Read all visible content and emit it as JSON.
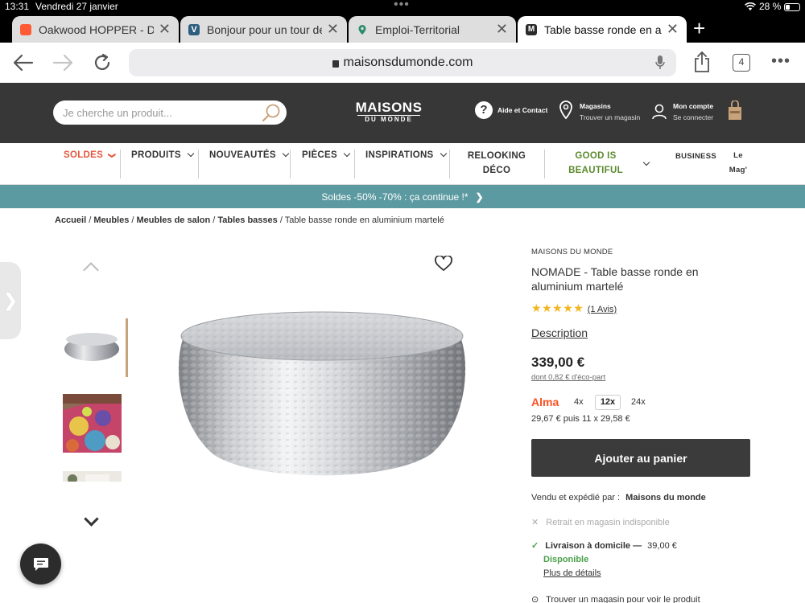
{
  "status": {
    "time": "13:31",
    "date": "Vendredi 27 janvier",
    "battery": "28 %"
  },
  "tabs": [
    {
      "title": "Oakwood HOPPER - Dou",
      "color": "#ff5a36"
    },
    {
      "title": "Bonjour pour un tour de",
      "color": "#2e5e7e"
    },
    {
      "title": "Emploi-Territorial",
      "color": "#2a8c6c"
    },
    {
      "title": "Table basse ronde en alu",
      "color": "#2b2b2b"
    }
  ],
  "browser": {
    "url": "maisonsdumonde.com",
    "tab_count": "4"
  },
  "header": {
    "search_placeholder": "Je cherche un produit...",
    "logo_line1": "MAISONS",
    "logo_line2": "DU MONDE",
    "help": "Aide et Contact",
    "stores_title": "Magasins",
    "stores_sub": "Trouver un magasin",
    "account_title": "Mon compte",
    "account_sub": "Se connecter"
  },
  "nav": [
    {
      "label": "SOLDES",
      "color": "#e4573d"
    },
    {
      "label": "PRODUITS",
      "color": "#333333"
    },
    {
      "label": "NOUVEAUTÉS",
      "color": "#333333"
    },
    {
      "label": "PIÈCES",
      "color": "#333333"
    },
    {
      "label": "INSPIRATIONS",
      "color": "#333333"
    },
    {
      "label1": "RELOOKING",
      "label2": "DÉCO"
    },
    {
      "label1": "GOOD IS",
      "label2": "BEAUTIFUL",
      "color": "#5a8a2c"
    },
    {
      "label": "BUSINESS"
    },
    {
      "label1": "Le",
      "label2": "Mag'"
    }
  ],
  "promo": "Soldes -50% -70% : ça continue !*",
  "breadcrumb": {
    "items": [
      "Accueil",
      "Meubles",
      "Meubles de salon",
      "Tables basses"
    ],
    "current": "Table basse ronde en aluminium martelé"
  },
  "product": {
    "brand": "MAISONS DU MONDE",
    "title_line1": "NOMADE - Table basse ronde en",
    "title_line2": "aluminium martelé",
    "rating": 5,
    "reviews": "(1 Avis)",
    "description_link": "Description",
    "price": "339,00 €",
    "eco_part": "dont 0,82 € d'éco-part",
    "alma": "Alma",
    "installments": [
      "4x",
      "12x",
      "24x"
    ],
    "installment_selected": "12x",
    "installment_detail": "29,67 € puis 11 x 29,58 €",
    "add_to_cart": "Ajouter au panier",
    "sold_by_label": "Vendu et expédié par :",
    "sold_by": "Maisons du monde",
    "store_pickup": "Retrait en magasin indisponible",
    "delivery_label": "Livraison à domicile —",
    "delivery_price": "39,00 €",
    "availability": "Disponible",
    "more_details": "Plus de détails",
    "find_store": "Trouver un magasin pour voir le produit"
  }
}
